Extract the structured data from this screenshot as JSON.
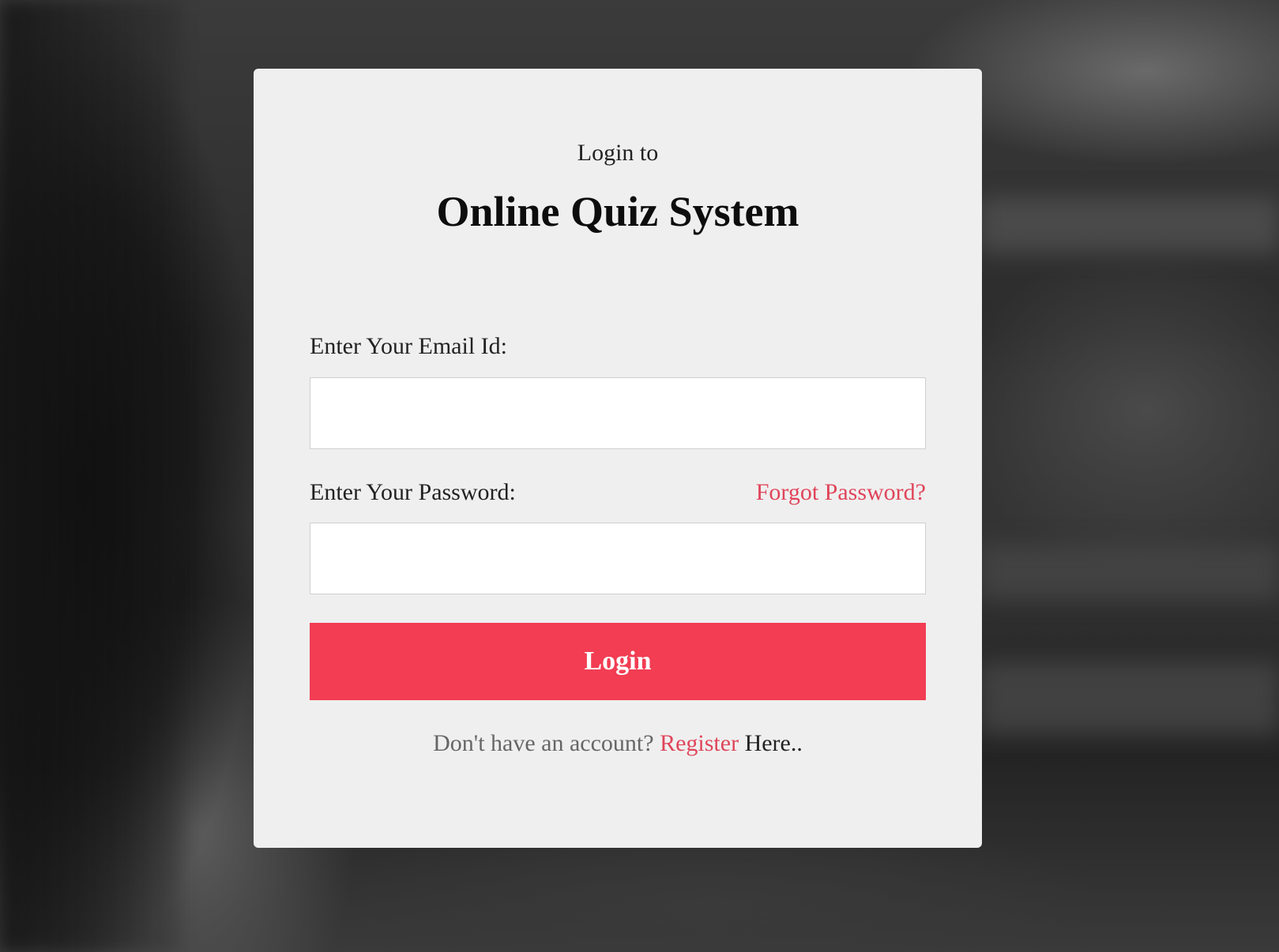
{
  "login": {
    "subtitle": "Login to",
    "title": "Online Quiz System",
    "email_label": "Enter Your Email Id:",
    "email_value": "",
    "password_label": "Enter Your Password:",
    "password_value": "",
    "forgot_link": "Forgot Password?",
    "submit_label": "Login",
    "footer_prefix": "Don't have an account? ",
    "register_link": "Register",
    "footer_suffix": " Here.."
  },
  "colors": {
    "accent": "#f23d53",
    "link": "#e0455a",
    "card_bg": "#efefef"
  }
}
